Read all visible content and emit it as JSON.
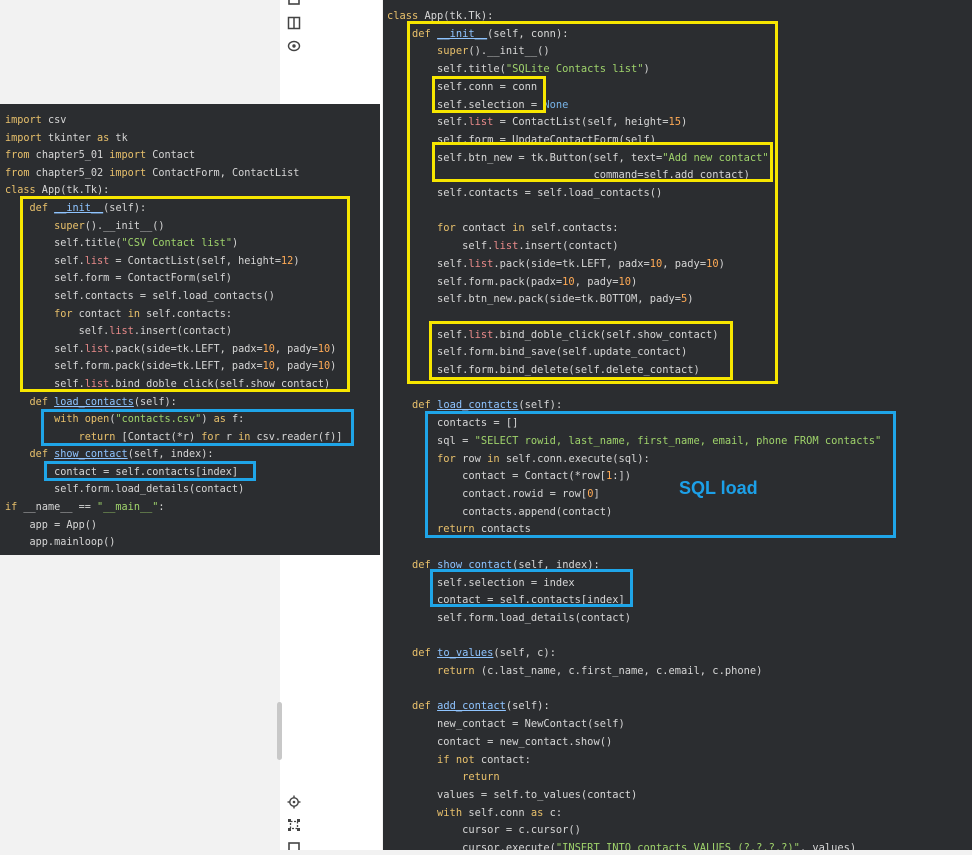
{
  "left_code": [
    [
      [
        "kw",
        "import"
      ],
      [
        "t",
        " csv"
      ]
    ],
    [
      [
        "kw",
        "import"
      ],
      [
        "t",
        " tkinter "
      ],
      [
        "kw",
        "as"
      ],
      [
        "t",
        " tk"
      ]
    ],
    [
      [
        "kw",
        "from"
      ],
      [
        "t",
        " chapter5_01 "
      ],
      [
        "kw",
        "import"
      ],
      [
        "t",
        " Contact"
      ]
    ],
    [
      [
        "kw",
        "from"
      ],
      [
        "t",
        " chapter5_02 "
      ],
      [
        "kw",
        "import"
      ],
      [
        "t",
        " ContactForm, ContactList"
      ]
    ],
    [
      [
        "kw",
        "class"
      ],
      [
        "t",
        " App(tk.Tk):"
      ]
    ],
    [
      [
        "t",
        "    "
      ],
      [
        "kw",
        "def"
      ],
      [
        "t",
        " "
      ],
      [
        "fn",
        "__init__"
      ],
      [
        "t",
        "(self):"
      ]
    ],
    [
      [
        "t",
        "        "
      ],
      [
        "kw",
        "super"
      ],
      [
        "t",
        "().__init__()"
      ]
    ],
    [
      [
        "t",
        "        self.title("
      ],
      [
        "str",
        "\"CSV Contact list\""
      ],
      [
        "t",
        ")"
      ]
    ],
    [
      [
        "t",
        "        self."
      ],
      [
        "attr",
        "list"
      ],
      [
        "t",
        " = ContactList(self, height="
      ],
      [
        "num",
        "12"
      ],
      [
        "t",
        ")"
      ]
    ],
    [
      [
        "t",
        "        self.form = ContactForm(self)"
      ]
    ],
    [
      [
        "t",
        "        self.contacts = self.load_contacts()"
      ]
    ],
    [
      [
        "t",
        "        "
      ],
      [
        "kw",
        "for"
      ],
      [
        "t",
        " contact "
      ],
      [
        "kw",
        "in"
      ],
      [
        "t",
        " self.contacts:"
      ]
    ],
    [
      [
        "t",
        "            self."
      ],
      [
        "attr",
        "list"
      ],
      [
        "t",
        ".insert(contact)"
      ]
    ],
    [
      [
        "t",
        "        self."
      ],
      [
        "attr",
        "list"
      ],
      [
        "t",
        ".pack(side=tk.LEFT, padx="
      ],
      [
        "num",
        "10"
      ],
      [
        "t",
        ", pady="
      ],
      [
        "num",
        "10"
      ],
      [
        "t",
        ")"
      ]
    ],
    [
      [
        "t",
        "        self.form.pack(side=tk.LEFT, padx="
      ],
      [
        "num",
        "10"
      ],
      [
        "t",
        ", pady="
      ],
      [
        "num",
        "10"
      ],
      [
        "t",
        ")"
      ]
    ],
    [
      [
        "t",
        "        self."
      ],
      [
        "attr",
        "list"
      ],
      [
        "t",
        ".bind_doble_click(self.show_contact)"
      ]
    ],
    [
      [
        "t",
        "    "
      ],
      [
        "kw",
        "def"
      ],
      [
        "t",
        " "
      ],
      [
        "fn",
        "load_contacts"
      ],
      [
        "t",
        "(self):"
      ]
    ],
    [
      [
        "t",
        "        "
      ],
      [
        "kw",
        "with"
      ],
      [
        "t",
        " "
      ],
      [
        "kw",
        "open"
      ],
      [
        "t",
        "("
      ],
      [
        "str",
        "\"contacts.csv\""
      ],
      [
        "t",
        ") "
      ],
      [
        "kw",
        "as"
      ],
      [
        "t",
        " f:"
      ]
    ],
    [
      [
        "t",
        "            "
      ],
      [
        "kw",
        "return"
      ],
      [
        "t",
        " [Contact(*r) "
      ],
      [
        "kw",
        "for"
      ],
      [
        "t",
        " r "
      ],
      [
        "kw",
        "in"
      ],
      [
        "t",
        " csv.reader(f)]"
      ]
    ],
    [
      [
        "t",
        "    "
      ],
      [
        "kw",
        "def"
      ],
      [
        "t",
        " "
      ],
      [
        "fn",
        "show_contact"
      ],
      [
        "t",
        "(self, index):"
      ]
    ],
    [
      [
        "t",
        "        contact = self.contacts[index]"
      ]
    ],
    [
      [
        "t",
        "        self.form.load_details(contact)"
      ]
    ],
    [
      [
        "kw",
        "if"
      ],
      [
        "t",
        " __name__ == "
      ],
      [
        "str",
        "\"__main__\""
      ],
      [
        "t",
        ":"
      ]
    ],
    [
      [
        "t",
        "    app = App()"
      ]
    ],
    [
      [
        "t",
        "    app.mainloop()"
      ]
    ]
  ],
  "right_code": [
    [
      [
        "kw",
        "class"
      ],
      [
        "t",
        " App(tk.Tk):"
      ]
    ],
    [
      [
        "t",
        "    "
      ],
      [
        "kw",
        "def"
      ],
      [
        "t",
        " "
      ],
      [
        "fn",
        "__init__"
      ],
      [
        "t",
        "(self, conn):"
      ]
    ],
    [
      [
        "t",
        "        "
      ],
      [
        "kw",
        "super"
      ],
      [
        "t",
        "().__init__()"
      ]
    ],
    [
      [
        "t",
        "        self.title("
      ],
      [
        "str",
        "\"SQLite Contacts list\""
      ],
      [
        "t",
        ")"
      ]
    ],
    [
      [
        "t",
        "        self.conn = conn"
      ]
    ],
    [
      [
        "t",
        "        self.selection = "
      ],
      [
        "id",
        "None"
      ]
    ],
    [
      [
        "t",
        "        self."
      ],
      [
        "attr",
        "list"
      ],
      [
        "t",
        " = ContactList(self, height="
      ],
      [
        "num",
        "15"
      ],
      [
        "t",
        ")"
      ]
    ],
    [
      [
        "t",
        "        self.form = UpdateContactForm(self)"
      ]
    ],
    [
      [
        "t",
        "        self.btn_new = tk.Button(self, text="
      ],
      [
        "str",
        "\"Add new contact\""
      ],
      [
        "t",
        ","
      ]
    ],
    [
      [
        "t",
        "                                 command=self.add_contact)"
      ]
    ],
    [
      [
        "t",
        "        self.contacts = self.load_contacts()"
      ]
    ],
    [
      [
        "t",
        ""
      ]
    ],
    [
      [
        "t",
        "        "
      ],
      [
        "kw",
        "for"
      ],
      [
        "t",
        " contact "
      ],
      [
        "kw",
        "in"
      ],
      [
        "t",
        " self.contacts:"
      ]
    ],
    [
      [
        "t",
        "            self."
      ],
      [
        "attr",
        "list"
      ],
      [
        "t",
        ".insert(contact)"
      ]
    ],
    [
      [
        "t",
        "        self."
      ],
      [
        "attr",
        "list"
      ],
      [
        "t",
        ".pack(side=tk.LEFT, padx="
      ],
      [
        "num",
        "10"
      ],
      [
        "t",
        ", pady="
      ],
      [
        "num",
        "10"
      ],
      [
        "t",
        ")"
      ]
    ],
    [
      [
        "t",
        "        self.form.pack(padx="
      ],
      [
        "num",
        "10"
      ],
      [
        "t",
        ", pady="
      ],
      [
        "num",
        "10"
      ],
      [
        "t",
        ")"
      ]
    ],
    [
      [
        "t",
        "        self.btn_new.pack(side=tk.BOTTOM, pady="
      ],
      [
        "num",
        "5"
      ],
      [
        "t",
        ")"
      ]
    ],
    [
      [
        "t",
        ""
      ]
    ],
    [
      [
        "t",
        "        self."
      ],
      [
        "attr",
        "list"
      ],
      [
        "t",
        ".bind_doble_click(self.show_contact)"
      ]
    ],
    [
      [
        "t",
        "        self.form.bind_save(self.update_contact)"
      ]
    ],
    [
      [
        "t",
        "        self.form.bind_delete(self.delete_contact)"
      ]
    ],
    [
      [
        "t",
        ""
      ]
    ],
    [
      [
        "t",
        "    "
      ],
      [
        "kw",
        "def"
      ],
      [
        "t",
        " "
      ],
      [
        "fn",
        "load_contacts"
      ],
      [
        "t",
        "(self):"
      ]
    ],
    [
      [
        "t",
        "        contacts = []"
      ]
    ],
    [
      [
        "t",
        "        sql = "
      ],
      [
        "str",
        "\"SELECT rowid, last_name, first_name, email, phone FROM contacts\""
      ]
    ],
    [
      [
        "t",
        "        "
      ],
      [
        "kw",
        "for"
      ],
      [
        "t",
        " row "
      ],
      [
        "kw",
        "in"
      ],
      [
        "t",
        " self.conn.execute(sql):"
      ]
    ],
    [
      [
        "t",
        "            contact = Contact(*row["
      ],
      [
        "num",
        "1"
      ],
      [
        "t",
        ":])"
      ]
    ],
    [
      [
        "t",
        "            contact.rowid = row["
      ],
      [
        "num",
        "0"
      ],
      [
        "t",
        "]"
      ]
    ],
    [
      [
        "t",
        "            contacts.append(contact)"
      ]
    ],
    [
      [
        "t",
        "        "
      ],
      [
        "kw",
        "return"
      ],
      [
        "t",
        " contacts"
      ]
    ],
    [
      [
        "t",
        ""
      ]
    ],
    [
      [
        "t",
        "    "
      ],
      [
        "kw",
        "def"
      ],
      [
        "t",
        " "
      ],
      [
        "fn",
        "show_contact"
      ],
      [
        "t",
        "(self, index):"
      ]
    ],
    [
      [
        "t",
        "        self.selection = index"
      ]
    ],
    [
      [
        "t",
        "        contact = self.contacts[index]"
      ]
    ],
    [
      [
        "t",
        "        self.form.load_details(contact)"
      ]
    ],
    [
      [
        "t",
        ""
      ]
    ],
    [
      [
        "t",
        "    "
      ],
      [
        "kw",
        "def"
      ],
      [
        "t",
        " "
      ],
      [
        "fn",
        "to_values"
      ],
      [
        "t",
        "(self, c):"
      ]
    ],
    [
      [
        "t",
        "        "
      ],
      [
        "kw",
        "return"
      ],
      [
        "t",
        " (c.last_name, c.first_name, c.email, c.phone)"
      ]
    ],
    [
      [
        "t",
        ""
      ]
    ],
    [
      [
        "t",
        "    "
      ],
      [
        "kw",
        "def"
      ],
      [
        "t",
        " "
      ],
      [
        "fn",
        "add_contact"
      ],
      [
        "t",
        "(self):"
      ]
    ],
    [
      [
        "t",
        "        new_contact = NewContact(self)"
      ]
    ],
    [
      [
        "t",
        "        contact = new_contact.show()"
      ]
    ],
    [
      [
        "t",
        "        "
      ],
      [
        "kw",
        "if not"
      ],
      [
        "t",
        " contact:"
      ]
    ],
    [
      [
        "t",
        "            "
      ],
      [
        "kw",
        "return"
      ]
    ],
    [
      [
        "t",
        "        values = self.to_values(contact)"
      ]
    ],
    [
      [
        "t",
        "        "
      ],
      [
        "kw",
        "with"
      ],
      [
        "t",
        " self.conn "
      ],
      [
        "kw",
        "as"
      ],
      [
        "t",
        " c:"
      ]
    ],
    [
      [
        "t",
        "            cursor = c.cursor()"
      ]
    ],
    [
      [
        "t",
        "            cursor.execute("
      ],
      [
        "str",
        "\"INSERT INTO contacts VALUES (?,?,?,?)\""
      ],
      [
        "t",
        ", values)"
      ]
    ]
  ],
  "annotation": {
    "sql_label": "SQL load"
  },
  "icons": [
    "square-icon",
    "book-icon",
    "eye-icon",
    "crosshair-icon",
    "transform-icon",
    "square-icon"
  ],
  "colors": {
    "highlight_yellow": "#f7e600",
    "highlight_blue": "#1fa5e8",
    "editor_bg": "#2b2d30"
  }
}
